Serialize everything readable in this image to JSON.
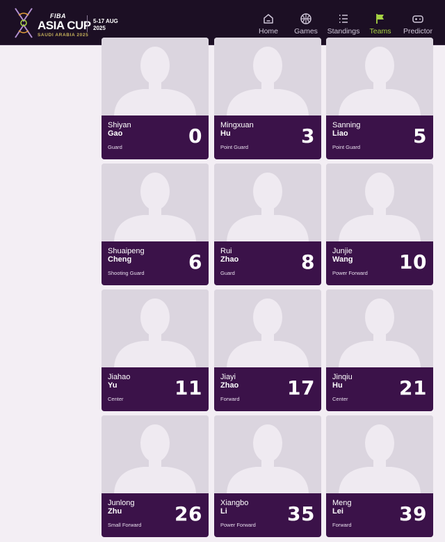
{
  "header": {
    "logo": {
      "fiba": "FIBA",
      "title": "ASIA CUP",
      "subtitle": "SAUDI ARABIA 2025"
    },
    "event_date_line1": "5-17 AUG",
    "event_date_line2": "2025",
    "nav": [
      {
        "label": "Home",
        "icon": "home-icon"
      },
      {
        "label": "Games",
        "icon": "basketball-icon"
      },
      {
        "label": "Standings",
        "icon": "list-icon"
      },
      {
        "label": "Teams",
        "icon": "flag-icon",
        "active": true
      },
      {
        "label": "Predictor",
        "icon": "gamepad-icon"
      }
    ],
    "active_color": "#a6d243"
  },
  "players": [
    {
      "first": "Shiyan",
      "last": "Gao",
      "position": "Guard",
      "number": "0"
    },
    {
      "first": "Mingxuan",
      "last": "Hu",
      "position": "Point Guard",
      "number": "3"
    },
    {
      "first": "Sanning",
      "last": "Liao",
      "position": "Point Guard",
      "number": "5"
    },
    {
      "first": "Shuaipeng",
      "last": "Cheng",
      "position": "Shooting Guard",
      "number": "6"
    },
    {
      "first": "Rui",
      "last": "Zhao",
      "position": "Guard",
      "number": "8"
    },
    {
      "first": "Junjie",
      "last": "Wang",
      "position": "Power Forward",
      "number": "10"
    },
    {
      "first": "Jiahao",
      "last": "Yu",
      "position": "Center",
      "number": "11"
    },
    {
      "first": "Jiayi",
      "last": "Zhao",
      "position": "Forward",
      "number": "17"
    },
    {
      "first": "Jinqiu",
      "last": "Hu",
      "position": "Center",
      "number": "21"
    },
    {
      "first": "Junlong",
      "last": "Zhu",
      "position": "Small Forward",
      "number": "26"
    },
    {
      "first": "Xiangbo",
      "last": "Li",
      "position": "Power Forward",
      "number": "35"
    },
    {
      "first": "Meng",
      "last": "Lei",
      "position": "Forward",
      "number": "39"
    }
  ],
  "colors": {
    "header_bg": "#1c0f24",
    "card_info_bg": "#3b1249",
    "page_bg": "#f3eef4"
  }
}
